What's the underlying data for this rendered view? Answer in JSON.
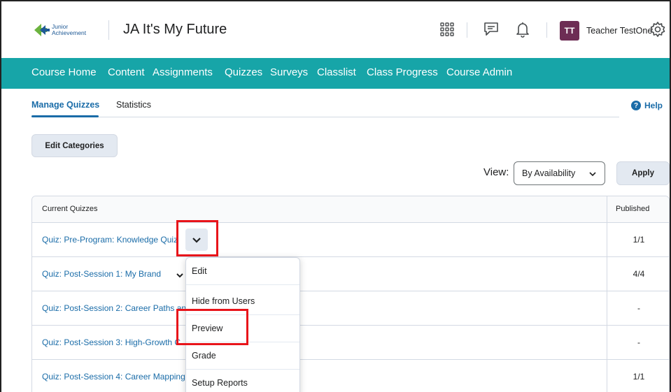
{
  "header": {
    "logo_text_line1": "Junior",
    "logo_text_line2": "Achievement",
    "course_title": "JA It's My Future",
    "avatar_initials": "TT",
    "user_name": "Teacher TestOne"
  },
  "nav": {
    "items": [
      "Course Home",
      "Content",
      "Assignments",
      "Quizzes",
      "Surveys",
      "Classlist",
      "Class Progress",
      "Course Admin"
    ]
  },
  "subtabs": {
    "manage": "Manage Quizzes",
    "statistics": "Statistics",
    "help": "Help"
  },
  "toolbar": {
    "edit_categories": "Edit Categories",
    "view_label": "View:",
    "view_value": "By Availability",
    "apply": "Apply"
  },
  "table": {
    "col_quizzes": "Current Quizzes",
    "col_published": "Published",
    "rows": [
      {
        "name": "Quiz: Pre-Program: Knowledge Quiz",
        "published": "1/1"
      },
      {
        "name": "Quiz: Post-Session 1: My Brand",
        "published": "4/4"
      },
      {
        "name": "Quiz: Post-Session 2: Career Paths and",
        "published": "-"
      },
      {
        "name": "Quiz: Post-Session 3: High-Growth C",
        "published": "-"
      },
      {
        "name": "Quiz: Post-Session 4: Career Mapping",
        "published": "1/1"
      }
    ]
  },
  "menu": {
    "items": [
      "Edit",
      "Hide from Users",
      "Preview",
      "Grade",
      "Setup Reports"
    ]
  },
  "colors": {
    "nav_bg": "#17a5a8",
    "link": "#1a6ca8",
    "avatar": "#6d2d54",
    "highlight": "#e8141a"
  }
}
